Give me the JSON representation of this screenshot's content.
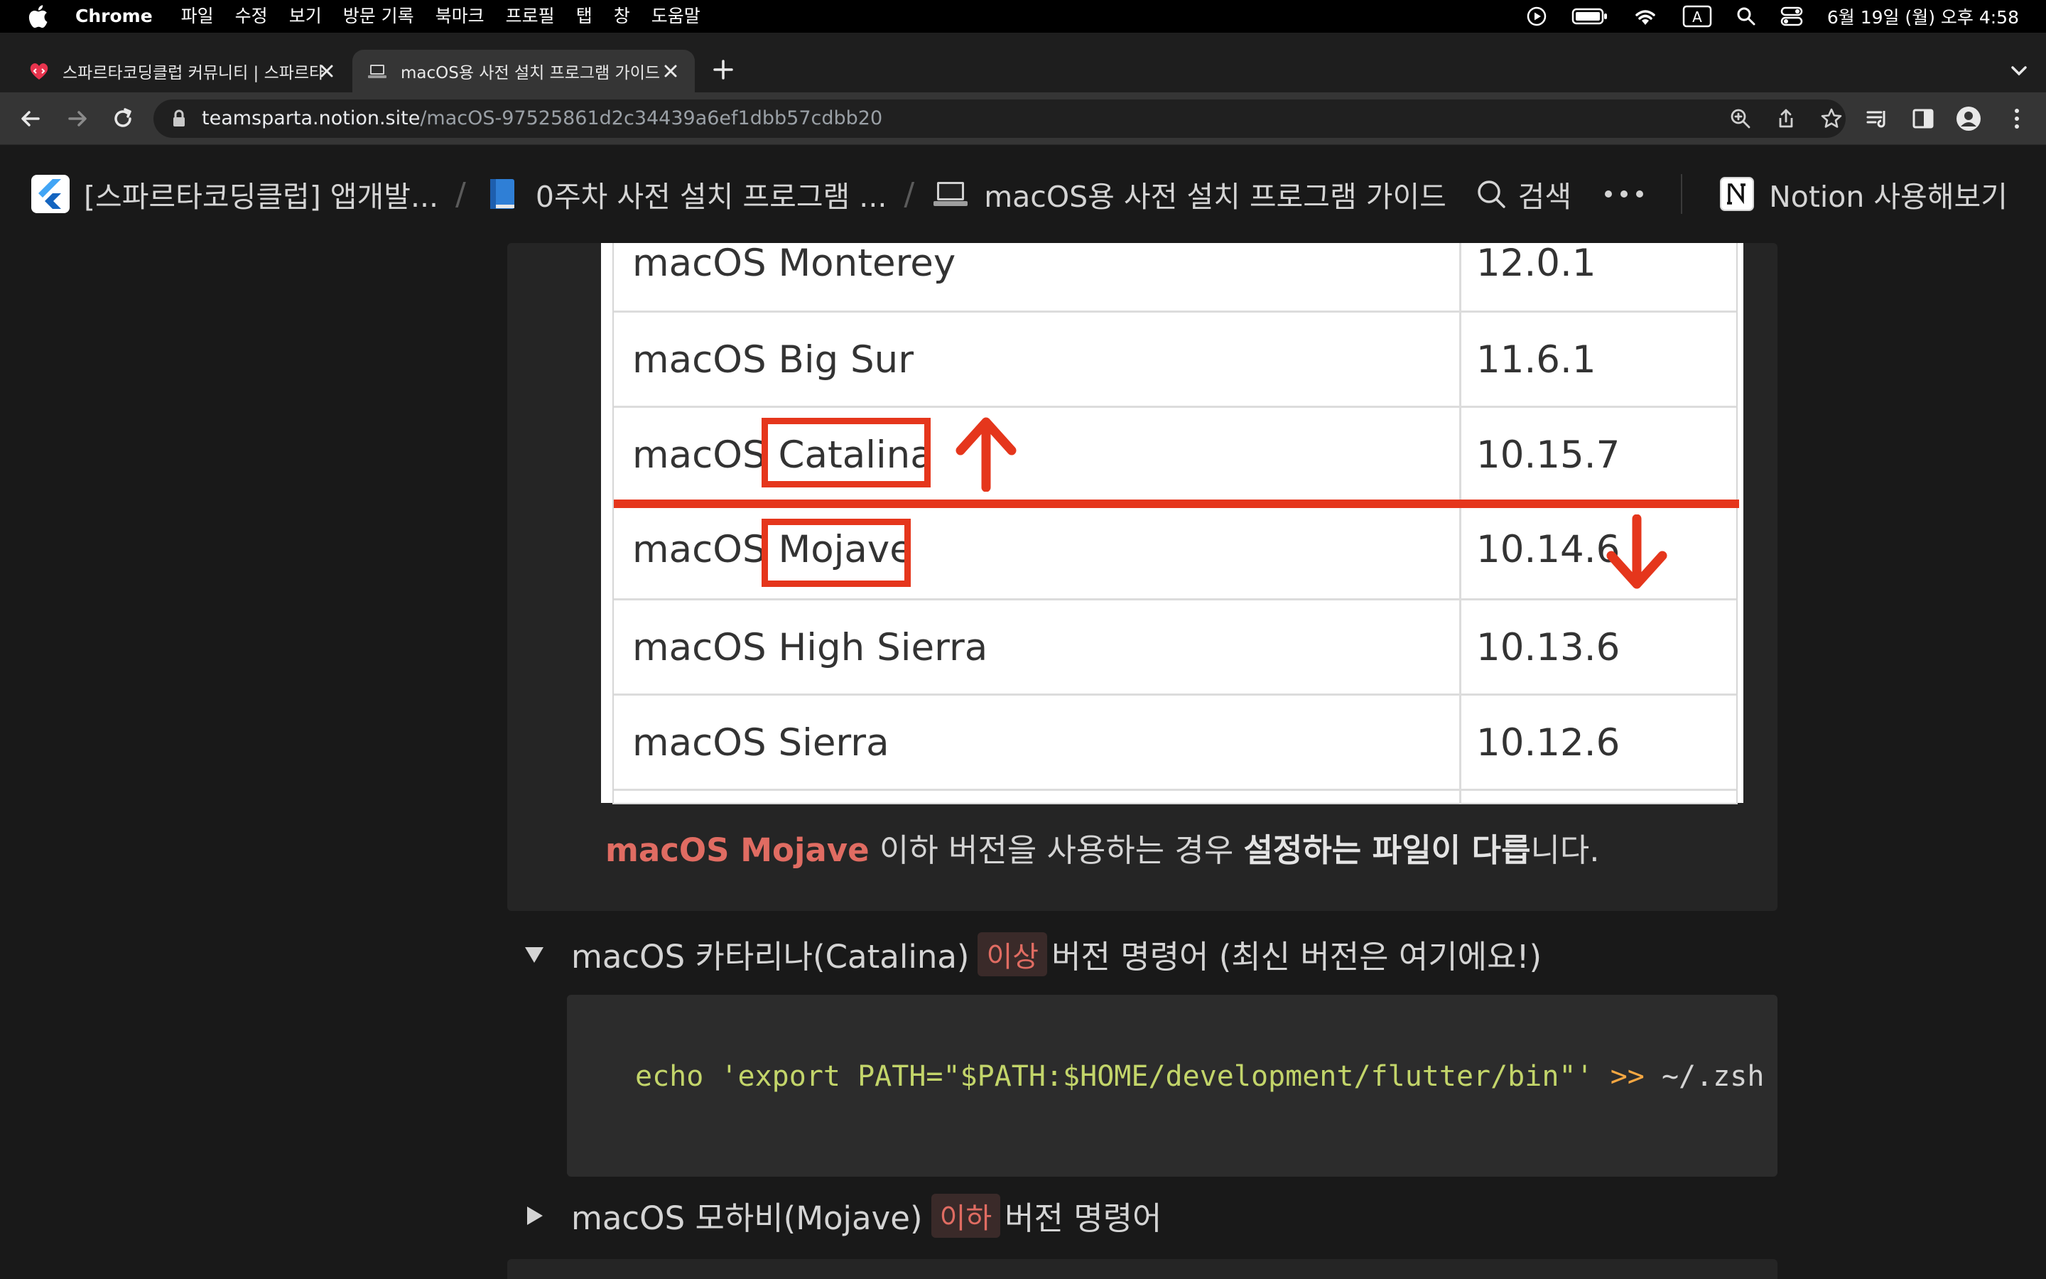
{
  "menubar": {
    "app": "Chrome",
    "menus": [
      "파일",
      "수정",
      "보기",
      "방문 기록",
      "북마크",
      "프로필",
      "탭",
      "창",
      "도움말"
    ],
    "clock": "6월 19일 (월) 오후 4:58",
    "input_indicator": "A"
  },
  "tabs": [
    {
      "title": "스파르타코딩클럽 커뮤니티 | 스파르타",
      "icon": "sparta-heart-icon",
      "active": false
    },
    {
      "title": "macOS용 사전 설치 프로그램 가이드",
      "icon": "laptop-icon",
      "active": true
    }
  ],
  "toolbar": {
    "url_host": "teamsparta.notion.site",
    "url_path": "/macOS-97525861d2c34439a6ef1dbb57cdbb20"
  },
  "notion": {
    "breadcrumbs": [
      {
        "label": "[스파르타코딩클럽] 앱개발...",
        "icon": "flutter-icon"
      },
      {
        "label": "0주차 사전 설치 프로그램 ...",
        "icon": "blue-book-icon"
      },
      {
        "label": "macOS용 사전 설치 프로그램 가이드",
        "icon": "laptop-icon"
      }
    ],
    "search_label": "검색",
    "try_notion_label": "Notion 사용해보기"
  },
  "version_table": [
    {
      "name": "macOS Monterey",
      "version": "12.0.1"
    },
    {
      "name": "macOS Big Sur",
      "version": "11.6.1"
    },
    {
      "name_prefix": "macOS",
      "name_highlight": "Catalina",
      "version": "10.15.7"
    },
    {
      "name_prefix": "macOS",
      "name_highlight": "Mojave",
      "version": "10.14.6"
    },
    {
      "name": "macOS High Sierra",
      "version": "10.13.6"
    },
    {
      "name": "macOS Sierra",
      "version": "10.12.6"
    }
  ],
  "note": {
    "highlight": "macOS Mojave",
    "text1": " 이하 버전을 사용하는 경우 ",
    "bold": "설정하는 파일이 다릅",
    "text2": "니다."
  },
  "toggles": [
    {
      "before": "macOS 카타리나(Catalina)",
      "tag": "이상",
      "after": "버전 명령어 (최신 버전은 여기에요!)",
      "open": true
    },
    {
      "before": "macOS 모하비(Mojave)",
      "tag": "이하",
      "after": "버전 명령어",
      "open": false
    }
  ],
  "code": {
    "string": "echo 'export PATH=\"$PATH:$HOME/development/flutter/bin\"'",
    "operator": ">>",
    "target": "~/.zsh"
  },
  "colors": {
    "accent_red": "#e5361c",
    "notion_red_text": "#e06c62",
    "code_string": "#c3d56a",
    "code_operator": "#f6a742",
    "background": "#191919"
  }
}
